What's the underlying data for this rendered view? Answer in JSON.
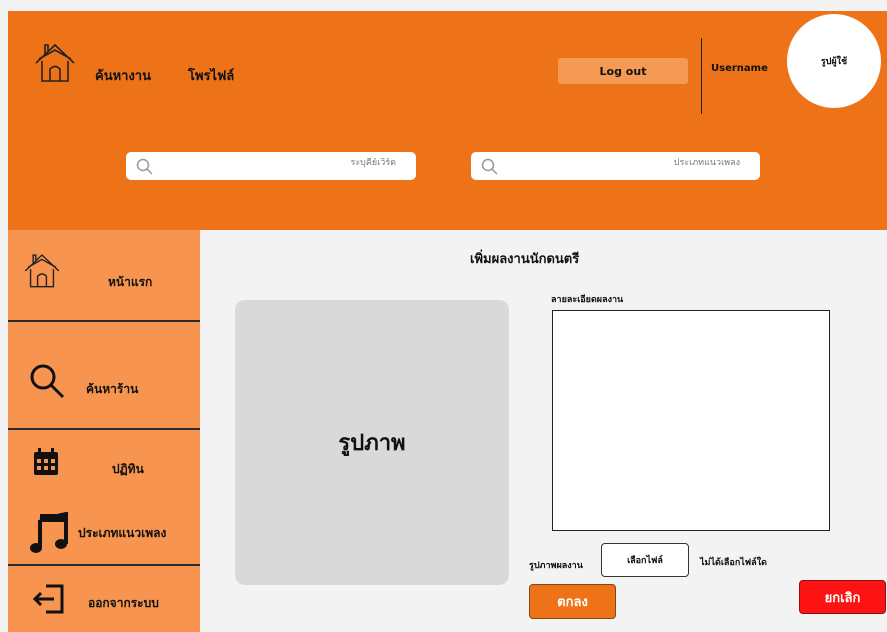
{
  "header": {
    "nav": {
      "jobs_label": "ค้นหางาน",
      "profile_label": "โพรไฟล์"
    },
    "logout_label": "Log out",
    "username": "Username",
    "avatar_label": "รูปผู้ใช้",
    "search_keyword_placeholder": "ระบุคีย์เวิร์ด",
    "search_genre_placeholder": "ประเภทแนวเพลง"
  },
  "sidebar": {
    "items": [
      {
        "label": "หน้าแรก",
        "icon": "home-icon"
      },
      {
        "label": "ค้นหาร้าน",
        "icon": "search-icon"
      },
      {
        "label": "ปฏิทิน",
        "icon": "calendar-icon"
      },
      {
        "label": "ประเภทแนวเพลง",
        "icon": "music-note-icon"
      },
      {
        "label": "ออกจากระบบ",
        "icon": "logout-icon"
      }
    ]
  },
  "main": {
    "title": "เพิ่มผลงานนักดนตรี",
    "image_placeholder": "รูปภาพ",
    "description_label": "ลายละเอียดผลงาน",
    "description_value": "",
    "file_label": "รูปภาพผลงาน",
    "choose_file_label": "เลือกไฟล์",
    "file_status": "ไม่ได้เลือกไฟล์ใด",
    "confirm_label": "ตกลง",
    "cancel_label": "ยกเลิก"
  },
  "colors": {
    "header_bg": "#ee7318",
    "sidebar_bg": "#f79550",
    "logout_bg": "#f59a54",
    "image_placeholder_bg": "#d9d9d9",
    "confirm_bg": "#ee7318",
    "cancel_bg": "#ff1212"
  }
}
